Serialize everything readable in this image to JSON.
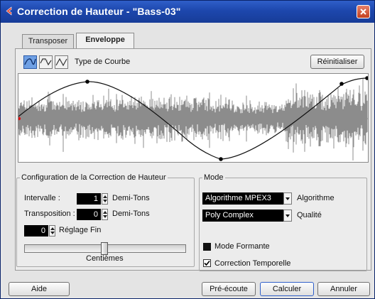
{
  "window": {
    "title": "Correction de Hauteur - \"Bass-03\""
  },
  "tabs": [
    {
      "label": "Transposer",
      "active": false
    },
    {
      "label": "Enveloppe",
      "active": true
    }
  ],
  "curve": {
    "type_label": "Type de Courbe",
    "buttons": [
      "spline",
      "damped",
      "linear"
    ],
    "reset_label": "Réinitialiser"
  },
  "config": {
    "legend": "Configuration de la Correction de Hauteur",
    "interval_label": "Intervalle :",
    "interval_value": "1",
    "interval_unit": "Demi-Tons",
    "transpose_label": "Transposition :",
    "transpose_value": "0",
    "transpose_unit": "Demi-Tons",
    "fine_value": "0",
    "fine_label": "Réglage Fin",
    "slider_label": "Centièmes",
    "slider_value_fraction": 0.5
  },
  "mode": {
    "legend": "Mode",
    "algorithm_value": "Algorithme MPEX3",
    "algorithm_label": "Algorithme",
    "quality_value": "Poly Complex",
    "quality_label": "Qualité",
    "formant_label": "Mode Formante",
    "formant_checked": false,
    "time_label": "Correction Temporelle",
    "time_checked": true
  },
  "footer": {
    "help": "Aide",
    "preview": "Pré-écoute",
    "calculate": "Calculer",
    "cancel": "Annuler"
  },
  "colors": {
    "titlebar": "#1d47ad",
    "accent": "#6fa0e4",
    "waveform": "#8a8a8a"
  }
}
